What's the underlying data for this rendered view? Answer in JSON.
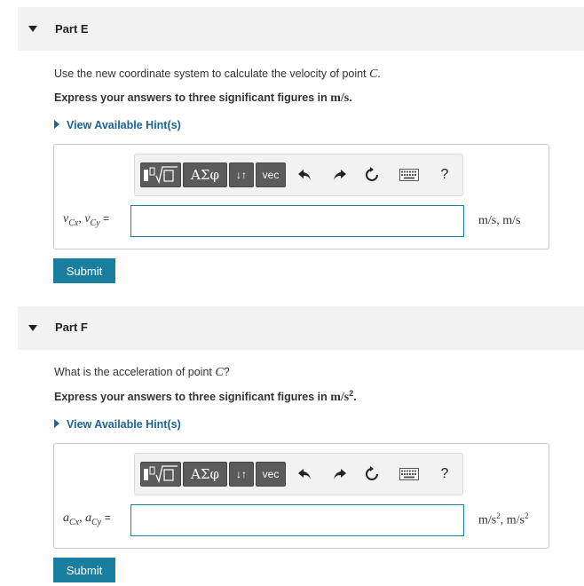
{
  "parts": [
    {
      "title": "Part E",
      "prompt_text": "Use the new coordinate system to calculate the velocity of point ",
      "prompt_point": "C",
      "prompt_end": ".",
      "instruction_text": "Express your answers to three significant figures in ",
      "instruction_unit": "m/s",
      "instruction_end": ".",
      "hint_label": "View Available Hint(s)",
      "answer_label": "v",
      "answer_label_sub": "Cx",
      "answer_label_sep": ", ",
      "answer_label2": "v",
      "answer_label2_sub": "Cy",
      "answer_eq": "=",
      "answer_value": "",
      "unit": "m/s, m/s",
      "submit_label": "Submit"
    },
    {
      "title": "Part F",
      "prompt_text": "What is the acceleration of point ",
      "prompt_point": "C",
      "prompt_end": "?",
      "instruction_text": "Express your answers to three significant figures in ",
      "instruction_unit": "m/s",
      "instruction_unit_sup": "2",
      "instruction_end": ".",
      "hint_label": "View Available Hint(s)",
      "answer_label": "a",
      "answer_label_sub": "Cx",
      "answer_label_sep": ", ",
      "answer_label2": "a",
      "answer_label2_sub": "Cy",
      "answer_eq": "=",
      "answer_value": "",
      "unit_a": "m/s",
      "unit_a_sup": "2",
      "unit_sep": ", ",
      "unit_b": "m/s",
      "unit_b_sup": "2",
      "submit_label": "Submit"
    }
  ],
  "toolbar": {
    "greek_label": "ΑΣφ",
    "arrows_label": "↓↑",
    "vec_label": "vec",
    "help_label": "?",
    "icons": [
      "templates-icon",
      "greek-icon",
      "arrows-icon",
      "vec-icon",
      "undo-icon",
      "redo-icon",
      "reset-icon",
      "keyboard-icon",
      "help-icon"
    ]
  },
  "colors": {
    "accent": "#1a7f9f",
    "link": "#1a6496",
    "header_bg": "#f2f2f2",
    "toolbar_button": "#5b5b5b"
  }
}
